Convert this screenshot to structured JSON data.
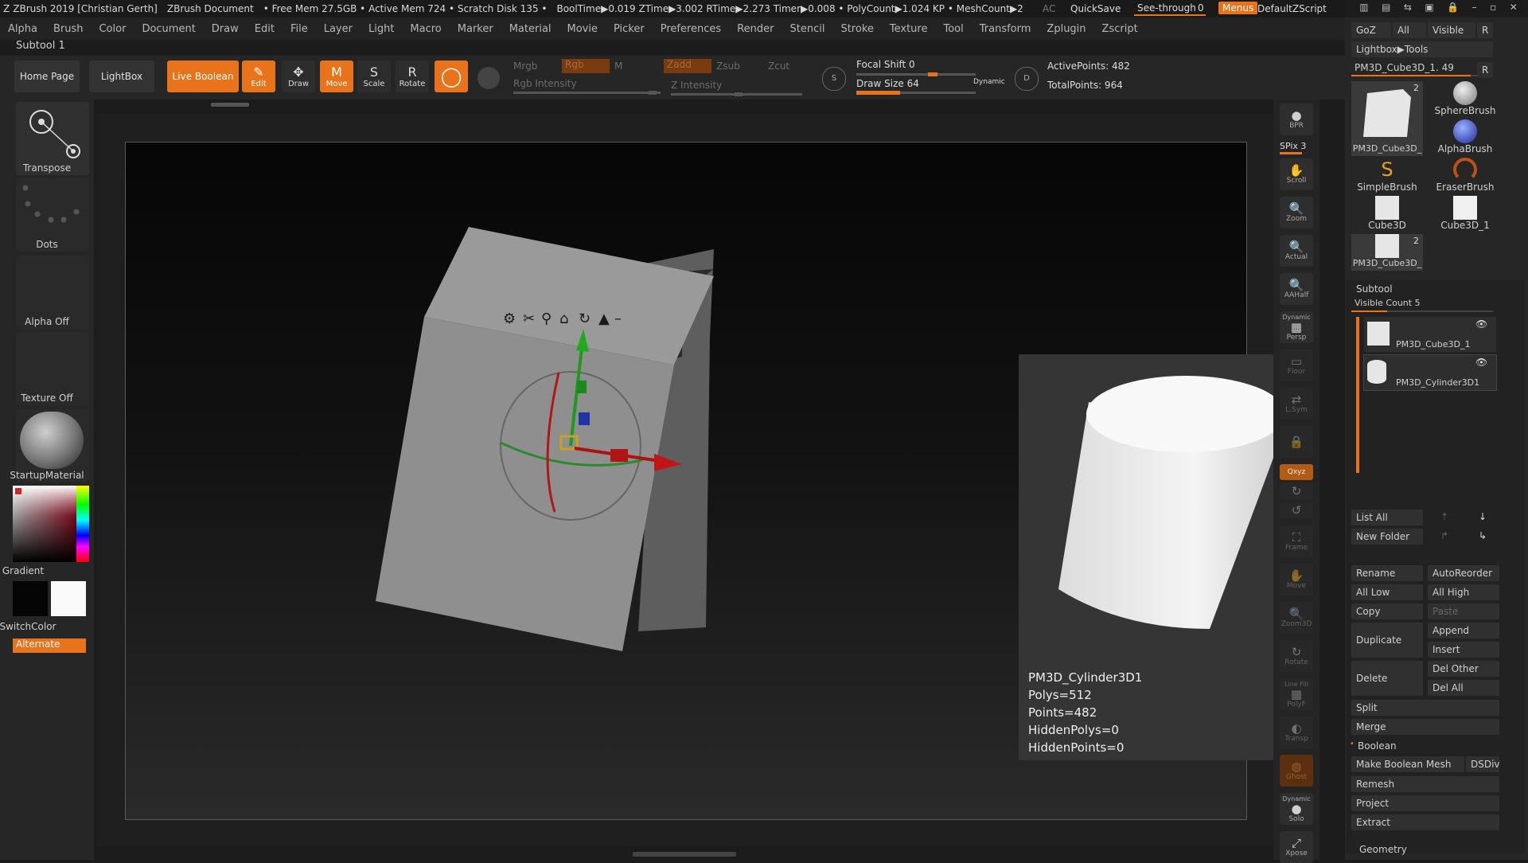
{
  "titlebar": {
    "app": "ZBrush 2019 [Christian Gerth]",
    "document": "ZBrush Document",
    "stats": "• Free Mem 27.5GB • Active Mem 724 • Scratch Disk 135 •",
    "timers": "BoolTime▶0.019 ZTime▶3.002 RTime▶2.273 Timer▶0.008 • PolyCount▶1.024 KP • MeshCount▶2",
    "ac": "AC",
    "quicksave": "QuickSave",
    "seethrough": "See-through",
    "seethrough_value": "0",
    "menus": "Menus",
    "script": "DefaultZScript"
  },
  "menubar": [
    "Alpha",
    "Brush",
    "Color",
    "Document",
    "Draw",
    "Edit",
    "File",
    "Layer",
    "Light",
    "Macro",
    "Marker",
    "Material",
    "Movie",
    "Picker",
    "Preferences",
    "Render",
    "Stencil",
    "Stroke",
    "Texture",
    "Tool",
    "Transform",
    "Zplugin",
    "Zscript"
  ],
  "subtool_label": "Subtool 1",
  "toolbar": {
    "home": "Home Page",
    "lightbox": "LightBox",
    "liveboolean": "Live Boolean",
    "edit": "Edit",
    "draw": "Draw",
    "move": "Move",
    "scale": "Scale",
    "rotate": "Rotate",
    "mrgb": "Mrgb",
    "rgb": "Rgb",
    "m": "M",
    "rgb_intensity": "Rgb Intensity",
    "zadd": "Zadd",
    "zsub": "Zsub",
    "zcut": "Zcut",
    "z_intensity": "Z Intensity",
    "focal_shift": "Focal Shift 0",
    "draw_size": "Draw Size 64",
    "dynamic": "Dynamic",
    "active_points": "ActivePoints: 482",
    "total_points": "TotalPoints: 964"
  },
  "leftshelf": {
    "transpose": "Transpose",
    "dots": "Dots",
    "alpha": "Alpha Off",
    "texture": "Texture Off",
    "material": "StartupMaterial",
    "gradient": "Gradient",
    "switchcolor": "SwitchColor",
    "alternate": "Alternate"
  },
  "rshelf": {
    "bpr": "BPR",
    "spix": "SPix 3",
    "scroll": "Scroll",
    "zoom": "Zoom",
    "actual": "Actual",
    "aahalf": "AAHalf",
    "dynamic": "Dynamic",
    "persp": "Persp",
    "floor": "Floor",
    "lsym": "L.Sym",
    "xyz": "Qxyz",
    "frame": "Frame",
    "move": "Move",
    "zoom3d": "Zoom3D",
    "rotate": "Rotate",
    "linefill": "Line Fill",
    "polyf": "PolyF",
    "transp": "Transp",
    "ghost": "Ghost",
    "solo": "Solo",
    "xpose": "Xpose"
  },
  "rpanel": {
    "goz": "GoZ",
    "all": "All",
    "visible": "Visible",
    "r": "R",
    "lightbox_tools": "Lightbox▶Tools",
    "current_tool": "PM3D_Cube3D_1. 49",
    "tools": [
      {
        "name": "PM3D_Cube3D_",
        "badge": "2"
      },
      {
        "name": "SphereBrush"
      },
      {
        "name": "AlphaBrush"
      },
      {
        "name": "SimpleBrush"
      },
      {
        "name": "EraserBrush"
      },
      {
        "name": "Cube3D"
      },
      {
        "name": "Cube3D_1"
      },
      {
        "name": "PM3D_Cube3D_",
        "badge": "2"
      }
    ],
    "subtool_header": "Subtool",
    "visible_count": "Visible Count 5",
    "subtools": [
      "PM3D_Cube3D_1",
      "PM3D_Cylinder3D1"
    ],
    "list_all": "List All",
    "new_folder": "New Folder",
    "rename": "Rename",
    "autoreorder": "AutoReorder",
    "all_low": "All Low",
    "all_high": "All High",
    "copy": "Copy",
    "paste": "Paste",
    "duplicate": "Duplicate",
    "append": "Append",
    "insert": "Insert",
    "delete": "Delete",
    "del_other": "Del Other",
    "del_all": "Del All",
    "split": "Split",
    "merge": "Merge",
    "boolean": "Boolean",
    "make_boolean_mesh": "Make Boolean Mesh",
    "dsdiv": "DSDiv",
    "remesh": "Remesh",
    "project": "Project",
    "extract": "Extract",
    "geometry": "Geometry"
  },
  "popup": {
    "name": "PM3D_Cylinder3D1",
    "polys": "Polys=512",
    "points": "Points=482",
    "hidden_polys": "HiddenPolys=0",
    "hidden_points": "HiddenPoints=0"
  },
  "colors": {
    "accent": "#e8731a",
    "panel": "#262626",
    "button": "#303030"
  }
}
